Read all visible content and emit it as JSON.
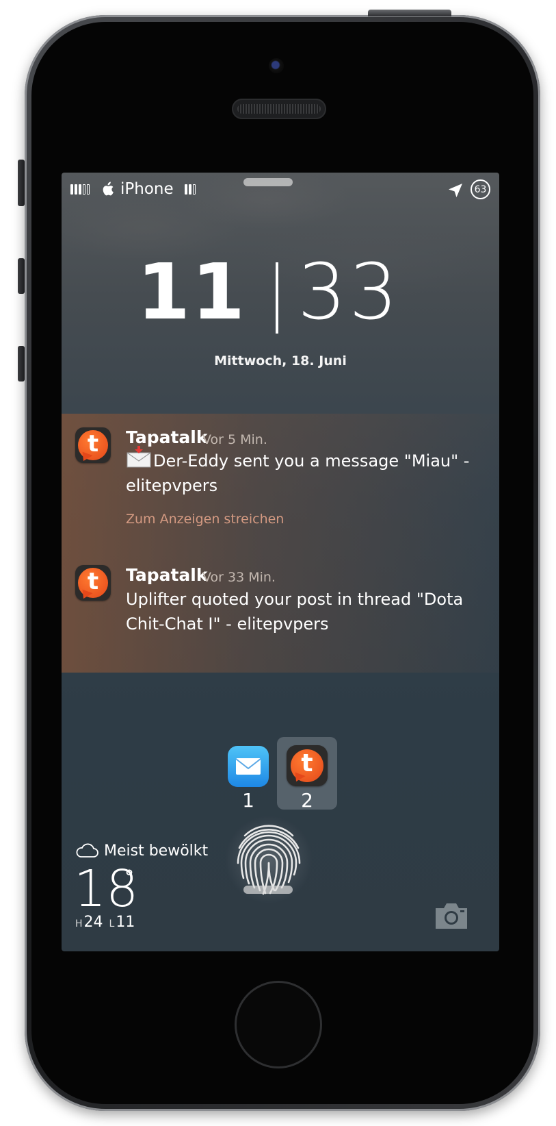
{
  "status_bar": {
    "carrier": "iPhone",
    "battery": "63",
    "signal_bars_on": 3,
    "signal_bars_total": 5,
    "wifi_bars_on": 2,
    "wifi_bars_total": 3
  },
  "lockscreen": {
    "hour": "11",
    "minute": "33",
    "date": "Mittwoch, 18. Juni"
  },
  "notifications": [
    {
      "app": "Tapatalk",
      "time": "Vor 5 Min.",
      "icon": "tapatalk-icon",
      "body": "Der-Eddy sent you a message \"Miau\" - elitepvpers",
      "body_prefix_icon": "envelope-download-icon",
      "hint": "Zum Anzeigen streichen"
    },
    {
      "app": "Tapatalk",
      "time": "Vor 33 Min.",
      "icon": "tapatalk-icon",
      "body": "Uplifter quoted your post in thread \"Dota Chit-Chat I\" - elitepvpers"
    }
  ],
  "notif_apps": [
    {
      "icon": "mail-icon",
      "count": "1",
      "selected": false
    },
    {
      "icon": "tapatalk-icon",
      "count": "2",
      "selected": true
    }
  ],
  "weather": {
    "icon": "cloud-icon",
    "condition": "Meist bewölkt",
    "temperature": "18",
    "degree": "°",
    "high_label": "H",
    "high": "24",
    "low_label": "L",
    "low": "11"
  },
  "colors": {
    "notif_tint": "#82543a",
    "tapatalk_orange": "#e4481a",
    "hint_text": "#d49a82"
  }
}
